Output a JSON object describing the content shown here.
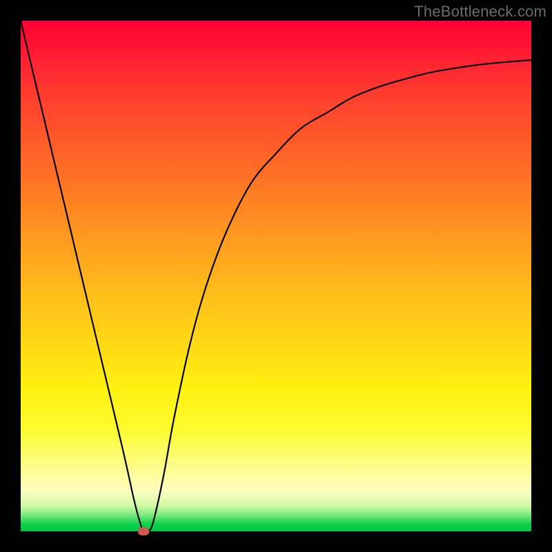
{
  "watermark": "TheBottleneck.com",
  "chart_data": {
    "type": "line",
    "title": "",
    "xlabel": "",
    "ylabel": "",
    "xlim": [
      0,
      100
    ],
    "ylim": [
      0,
      100
    ],
    "grid": false,
    "legend": false,
    "series": [
      {
        "name": "curve",
        "x": [
          0,
          5,
          10,
          15,
          20,
          22,
          23,
          24,
          25,
          26,
          28,
          30,
          33,
          36,
          40,
          45,
          50,
          55,
          60,
          65,
          70,
          75,
          80,
          85,
          90,
          95,
          100
        ],
        "y": [
          100,
          79,
          58,
          37,
          16,
          7,
          3,
          0,
          0,
          2,
          11,
          22,
          36,
          47,
          58,
          68,
          74,
          79,
          82,
          85,
          87,
          88.5,
          89.8,
          90.7,
          91.4,
          91.9,
          92.3
        ]
      }
    ],
    "marker": {
      "x": 24,
      "y": 0,
      "color": "#cc5a4e"
    },
    "curve_color": "#000000",
    "gradient_stops": [
      {
        "pos": 0,
        "color": "#ff0033"
      },
      {
        "pos": 50,
        "color": "#ffbf1a"
      },
      {
        "pos": 85,
        "color": "#fdfd7a"
      },
      {
        "pos": 100,
        "color": "#00c93f"
      }
    ]
  }
}
